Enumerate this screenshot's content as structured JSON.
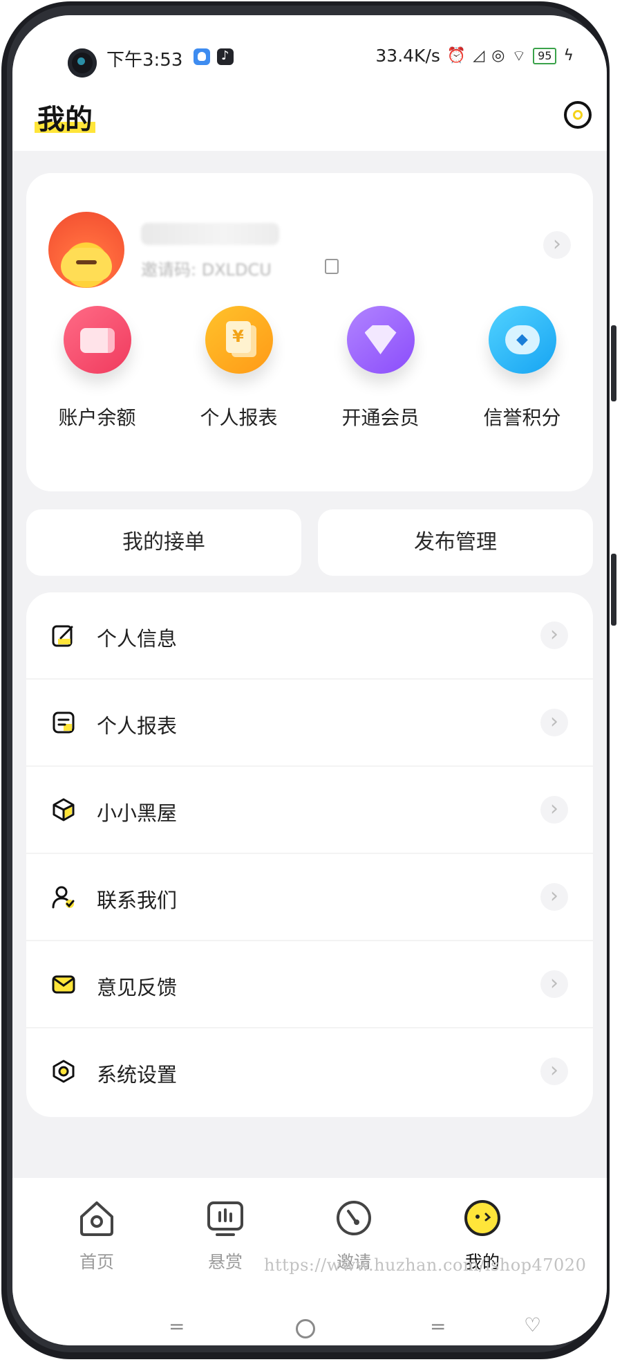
{
  "status_bar": {
    "time": "下午3:53",
    "net_speed": "33.4K/s",
    "battery": "95"
  },
  "header": {
    "title": "我的"
  },
  "profile": {
    "id_text": "邀请码: DXLDCU"
  },
  "quick_actions": [
    {
      "label": "账户余额",
      "icon": "wallet-icon"
    },
    {
      "label": "个人报表",
      "icon": "report-icon"
    },
    {
      "label": "开通会员",
      "icon": "vip-diamond-icon"
    },
    {
      "label": "信誉积分",
      "icon": "credit-score-icon"
    }
  ],
  "buttons": {
    "my_orders": "我的接单",
    "publish_manage": "发布管理"
  },
  "menu": [
    {
      "label": "个人信息",
      "icon": "edit-profile-icon"
    },
    {
      "label": "个人报表",
      "icon": "report-list-icon"
    },
    {
      "label": "小小黑屋",
      "icon": "box-icon"
    },
    {
      "label": "联系我们",
      "icon": "contact-icon"
    },
    {
      "label": "意见反馈",
      "icon": "mail-icon"
    },
    {
      "label": "系统设置",
      "icon": "settings-icon"
    }
  ],
  "tabs": [
    {
      "label": "首页",
      "icon": "home-icon"
    },
    {
      "label": "悬赏",
      "icon": "reward-icon"
    },
    {
      "label": "邀请",
      "icon": "invite-icon"
    },
    {
      "label": "我的",
      "icon": "profile-face-icon"
    }
  ],
  "watermark": "https://www.huzhan.com/ishop47020",
  "colors": {
    "accent_yellow": "#ffe53a",
    "wallet": "#f03b5e",
    "report": "#ff9a17",
    "vip": "#8b4dfb",
    "credit": "#17a4f2"
  }
}
